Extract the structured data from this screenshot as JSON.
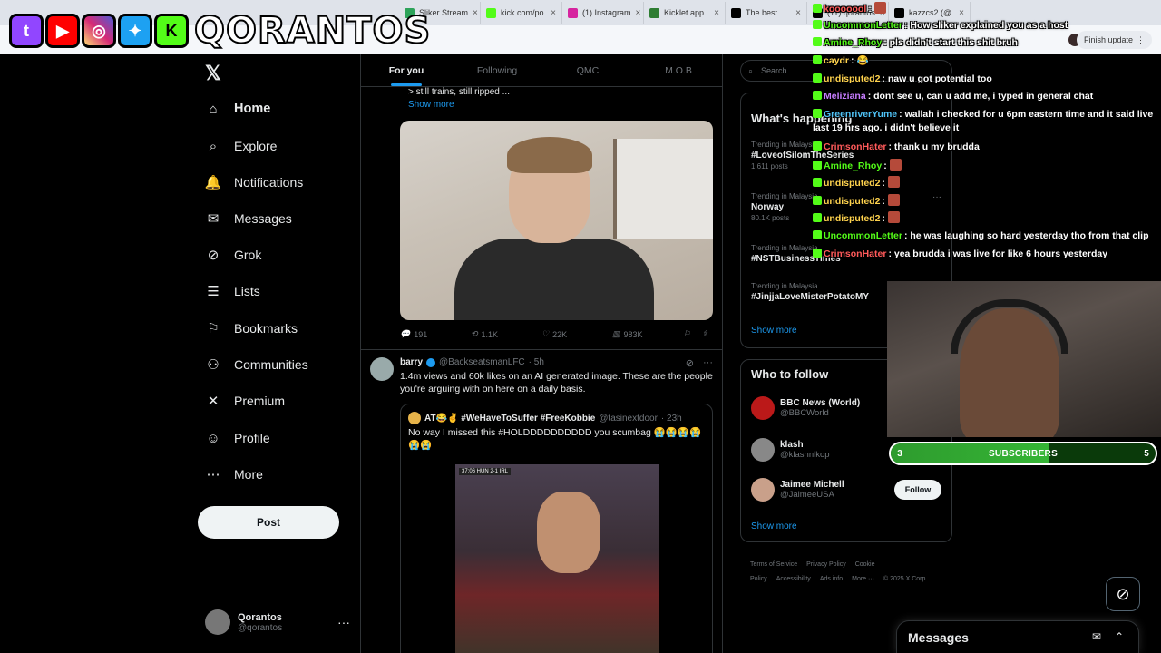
{
  "browser": {
    "tabs": [
      {
        "label": "Sliker Stream",
        "color": "#2da35a"
      },
      {
        "label": "kick.com/po",
        "color": "#53fc18"
      },
      {
        "label": "(1) Instagram",
        "color": "#d6249f"
      },
      {
        "label": "Kicklet.app",
        "color": "#2e7d32"
      },
      {
        "label": "The best",
        "color": "#000000"
      },
      {
        "label": "(11) qorantos",
        "color": "#000000"
      },
      {
        "label": "kazzcs2 (@",
        "color": "#000000"
      }
    ],
    "finish_update": "Finish update"
  },
  "overlay": {
    "brand": "QORANTOS",
    "social_icons": [
      "twitch-icon",
      "youtube-icon",
      "instagram-icon",
      "twitter-icon",
      "kick-icon"
    ],
    "chat": [
      {
        "user": "kooooool",
        "text": "",
        "color": "#ff5a5a"
      },
      {
        "user": "UncommonLetter",
        "text": "How sliker explained you as a host",
        "color": "#53fc18"
      },
      {
        "user": "Amine_Rhoy",
        "text": "pls didn't start this shit bruh",
        "color": "#53fc18"
      },
      {
        "user": "caydr",
        "text": "😂",
        "color": "#ffd34e"
      },
      {
        "user": "undisputed2",
        "text": "naw u got potential too",
        "color": "#ffd34e"
      },
      {
        "user": "Meliziana",
        "text": "dont see u, can u add me, i typed in general chat",
        "color": "#c77dff"
      },
      {
        "user": "GreenriverYume",
        "text": "wallah i checked for u 6pm eastern time and it said live last 19 hrs ago. i didn't believe it",
        "color": "#4fc3f7"
      },
      {
        "user": "CrimsonHater",
        "text": "thank u my brudda",
        "color": "#ff5a5a"
      },
      {
        "user": "Amine_Rhoy",
        "text": "",
        "color": "#53fc18"
      },
      {
        "user": "undisputed2",
        "text": "",
        "color": "#ffd34e"
      },
      {
        "user": "undisputed2",
        "text": "",
        "color": "#ffd34e"
      },
      {
        "user": "undisputed2",
        "text": "",
        "color": "#ffd34e"
      },
      {
        "user": "UncommonLetter",
        "text": "he was laughing so hard yesterday tho from that clip",
        "color": "#53fc18"
      },
      {
        "user": "CrimsonHater",
        "text": "yea brudda i was live for like 6 hours yesterday",
        "color": "#ff5a5a"
      }
    ],
    "subscribers": {
      "label": "SUBSCRIBERS",
      "current": "3",
      "goal": "5",
      "progress": 0.6
    }
  },
  "nav": {
    "items": [
      {
        "label": "Home",
        "icon": "home-icon",
        "glyph": "⌂"
      },
      {
        "label": "Explore",
        "icon": "search-icon",
        "glyph": "⌕"
      },
      {
        "label": "Notifications",
        "icon": "bell-icon",
        "glyph": "🔔"
      },
      {
        "label": "Messages",
        "icon": "mail-icon",
        "glyph": "✉"
      },
      {
        "label": "Grok",
        "icon": "grok-icon",
        "glyph": "⊘"
      },
      {
        "label": "Lists",
        "icon": "list-icon",
        "glyph": "☰"
      },
      {
        "label": "Bookmarks",
        "icon": "bookmark-icon",
        "glyph": "⚐"
      },
      {
        "label": "Communities",
        "icon": "people-icon",
        "glyph": "⚇"
      },
      {
        "label": "Premium",
        "icon": "x-icon",
        "glyph": "✕"
      },
      {
        "label": "Profile",
        "icon": "person-icon",
        "glyph": "☺"
      },
      {
        "label": "More",
        "icon": "more-icon",
        "glyph": "⋯"
      }
    ],
    "post_label": "Post",
    "account": {
      "name": "Qorantos",
      "handle": "@qorantos"
    }
  },
  "feed": {
    "tabs": [
      "For you",
      "Following",
      "QMC",
      "M.O.B"
    ],
    "tweet1": {
      "text_tail": "> still trains, still ripped  ...",
      "show_more": "Show more",
      "stats": {
        "replies": "191",
        "reposts": "1.1K",
        "likes": "22K",
        "views": "983K"
      }
    },
    "tweet2": {
      "name": "barry",
      "handle": "@BackseatsmanLFC",
      "time": "· 5h",
      "text": "1.4m views and 60k likes on an AI generated image. These are the people you're arguing with on here on a daily basis.",
      "quote": {
        "name": "AT😂✌ #WeHaveToSuffer #FreeKobbie",
        "handle": "@tasinextdoor",
        "time": "· 23h",
        "text": "No way I missed this #HOLDDDDDDDDDD you scumbag 😭😭😭😭😭😭",
        "scoreboard": "37:06 HUN 2-1 IRL"
      }
    }
  },
  "sidebar": {
    "search_placeholder": "Search",
    "happening_title": "What's happening",
    "trends": [
      {
        "context": "Trending in Malaysia",
        "topic": "#LoveofSilomTheSeries",
        "posts": "1,611 posts"
      },
      {
        "context": "Trending in Malaysia",
        "topic": "Norway",
        "posts": "80.1K posts"
      },
      {
        "context": "Trending in Malaysia",
        "topic": "#NSTBusinessTimes",
        "posts": ""
      },
      {
        "context": "Trending in Malaysia",
        "topic": "#JinjjaLoveMisterPotatoMY",
        "posts": ""
      }
    ],
    "show_more": "Show more",
    "wtf_title": "Who to follow",
    "who_to_follow": [
      {
        "name": "BBC News (World)",
        "handle": "@BBCWorld",
        "color": "#bb1919"
      },
      {
        "name": "klash",
        "handle": "@klashnlkop",
        "color": "#888888"
      },
      {
        "name": "Jaimee Michell",
        "handle": "@JaimeeUSA",
        "color": "#c9a08a"
      }
    ],
    "follow_label": "Follow",
    "footer": [
      "Terms of Service",
      "Privacy Policy",
      "Cookie Policy",
      "Accessibility",
      "Ads info",
      "More ···",
      "© 2025 X Corp."
    ]
  },
  "messages_drawer": {
    "title": "Messages"
  }
}
